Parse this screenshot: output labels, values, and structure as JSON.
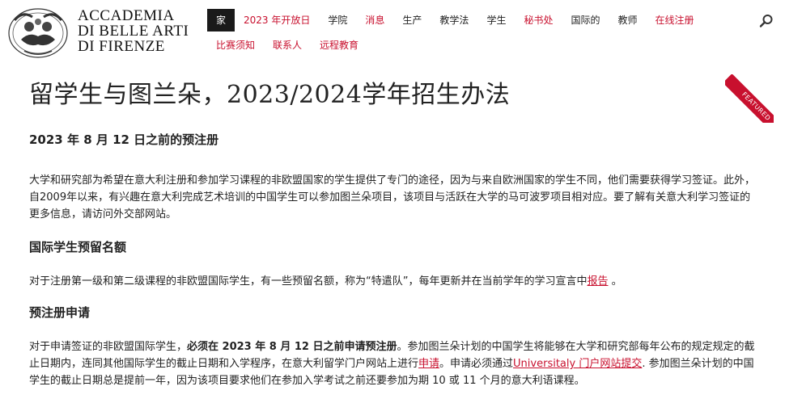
{
  "logo": {
    "line1": "ACCADEMIA",
    "line2": "DI BELLE ARTI",
    "line3": "DI FIRENZE",
    "emblem_icon": "cherub-emblem-icon"
  },
  "nav": {
    "row1": [
      {
        "label": "家",
        "state": "active"
      },
      {
        "label": "2023 年开放日",
        "state": "red"
      },
      {
        "label": "学院",
        "state": "dark"
      },
      {
        "label": "消息",
        "state": "red"
      },
      {
        "label": "生产",
        "state": "dark"
      },
      {
        "label": "教学法",
        "state": "dark"
      },
      {
        "label": "学生",
        "state": "dark"
      },
      {
        "label": "秘书处",
        "state": "red"
      },
      {
        "label": "国际的",
        "state": "dark"
      },
      {
        "label": "教师",
        "state": "dark"
      },
      {
        "label": "在线注册",
        "state": "red"
      }
    ],
    "row2": [
      {
        "label": "比赛须知",
        "state": "red"
      },
      {
        "label": "联系人",
        "state": "red"
      },
      {
        "label": "远程教育",
        "state": "red"
      }
    ],
    "search_icon": "search-icon"
  },
  "ribbon": {
    "label": "FEATURED"
  },
  "colors": {
    "accent": "#c8102e",
    "text": "#222222",
    "active_bg": "#1a1a1a"
  },
  "article": {
    "title": "留学生与图兰朵，2023/2024学年招生办法",
    "subtitle": "2023 年 8 月 12 日之前的预注册",
    "p1": "大学和研究部为希望在意大利注册和参加学习课程的非欧盟国家的学生提供了专门的途径，因为与来自欧洲国家的学生不同，他们需要获得学习签证。此外，自2009年以来，有兴趣在意大利完成艺术培训的中国学生可以参加图兰朵项目，该项目与活跃在大学的马可波罗项目相对应。要了解有关意大利学习签证的更多信息，请访问外交部网站。",
    "section1": "国际学生预留名额",
    "p2_text": "对于注册第一级和第二级课程的非欧盟国际学生，有一些预留名额，称为“特遣队”，每年更新并在当前学年的学习宣言中",
    "p2_link": "报告",
    "p2_end": " 。",
    "section2": "预注册申请",
    "p3_a": "对于申请签证的非欧盟国际学生，",
    "p3_bold": "必须在 2023 年 8 月 12 日之前申请预注册",
    "p3_b": "。参加图兰朵计划的中国学生将能够在大学和研究部每年公布的规定规定的截止日期内，连同其他国际学生的截止日期和入学程序，在意大利留学门户网站上进行",
    "p3_link1": "申请",
    "p3_c": "。申请必须通过",
    "p3_link2": "Universitaly 门户网站提交",
    "p3_d": ". 参加图兰朵计划的中国学生的截止日期总是提前一年，因为该项目要求他们在参加入学考试之前还要参加为期 10 或 11 个月的意大利语课程。"
  }
}
